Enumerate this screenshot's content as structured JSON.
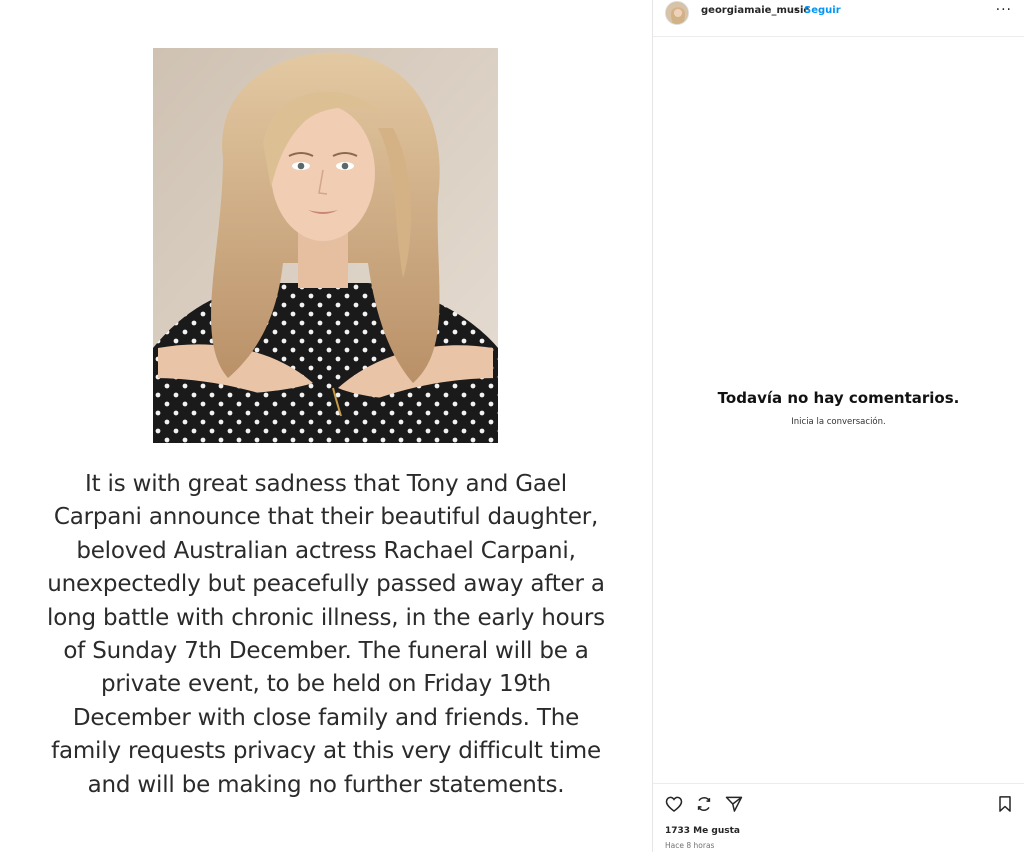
{
  "post": {
    "text": "It is with great sadness that Tony and Gael Carpani announce that their beautiful daughter, beloved Australian actress Rachael Carpani, unexpectedly but peacefully passed away after a long battle with chronic illness, in the early hours of Sunday 7th December. The funeral will be a private event, to be held on Friday 19th December with close family and friends. The family requests privacy at this very difficult time and will be making no further statements.",
    "photo_icon": "portrait-photo"
  },
  "header": {
    "username": "georgiamaie_music",
    "separator": "•",
    "follow_label": "Seguir",
    "more_label": "···"
  },
  "comments": {
    "empty_title": "Todavía no hay comentarios.",
    "empty_subtitle": "Inicia la conversación."
  },
  "footer": {
    "likes": "1733 Me gusta",
    "time": "Hace 8 horas",
    "icons": [
      "heart-icon",
      "repost-icon",
      "share-icon",
      "bookmark-icon"
    ]
  },
  "colors": {
    "accent": "#0095f6",
    "text": "#262626",
    "muted": "#737373"
  }
}
